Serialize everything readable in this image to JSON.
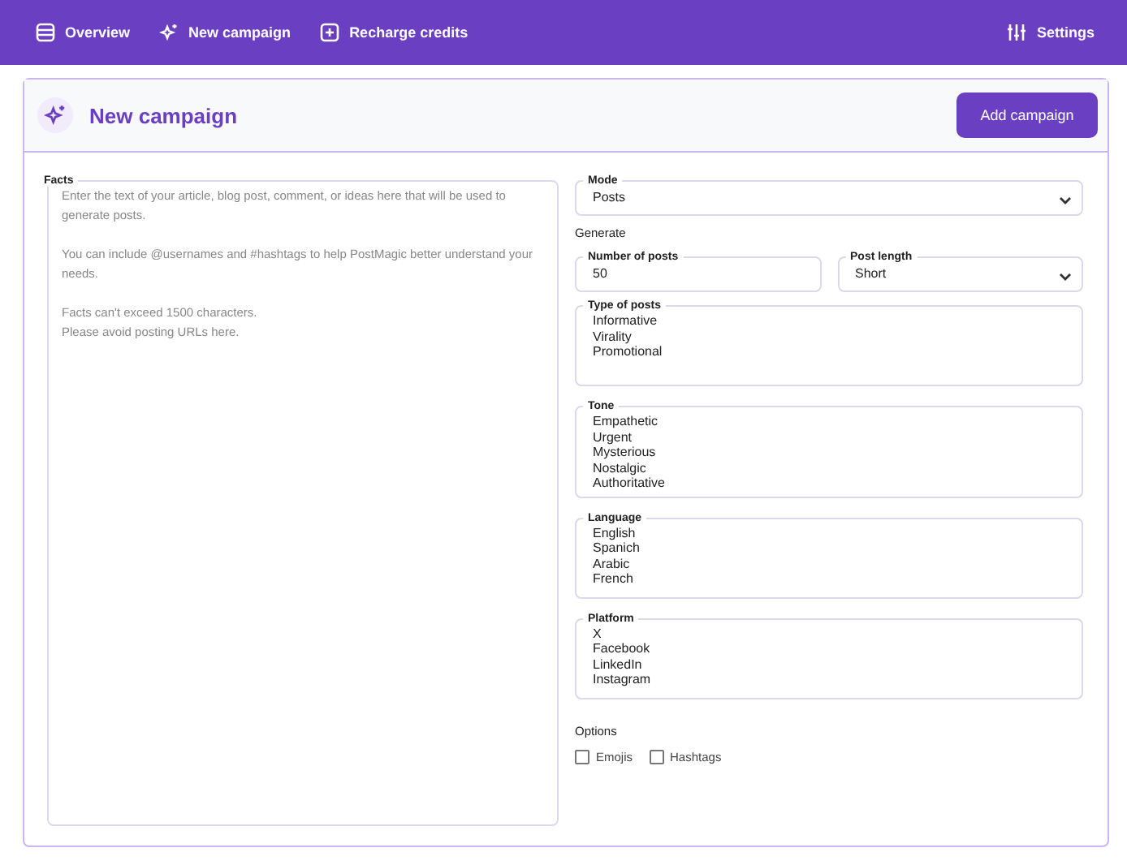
{
  "nav": {
    "items": [
      {
        "label": "Overview"
      },
      {
        "label": "New campaign"
      },
      {
        "label": "Recharge credits"
      }
    ],
    "settings": "Settings"
  },
  "header": {
    "title": "New campaign",
    "button": "Add campaign"
  },
  "facts": {
    "label": "Facts",
    "placeholder": "Enter the text of your article, blog post, comment, or ideas here that will be used to generate posts.\n\nYou can include @usernames and #hashtags to help PostMagic better understand your needs.\n\nFacts can't exceed 1500 characters.\nPlease avoid posting URLs here."
  },
  "mode": {
    "label": "Mode",
    "value": "Posts"
  },
  "generate_label": "Generate",
  "number_of_posts": {
    "label": "Number of posts",
    "value": "50"
  },
  "post_length": {
    "label": "Post length",
    "value": "Short"
  },
  "lists": [
    {
      "label": "Type of posts",
      "options": [
        "Informative",
        "Virality",
        "Promotional"
      ]
    },
    {
      "label": "Tone",
      "options": [
        "Empathetic",
        "Urgent",
        "Mysterious",
        "Nostalgic",
        "Authoritative"
      ]
    },
    {
      "label": "Language",
      "options": [
        "English",
        "Spanich",
        "Arabic",
        "French"
      ]
    },
    {
      "label": "Platform",
      "options": [
        "X",
        "Facebook",
        "LinkedIn",
        "Instagram"
      ]
    }
  ],
  "options_label": "Options",
  "options": [
    {
      "label": "Emojis",
      "checked": false
    },
    {
      "label": "Hashtags",
      "checked": false
    }
  ]
}
